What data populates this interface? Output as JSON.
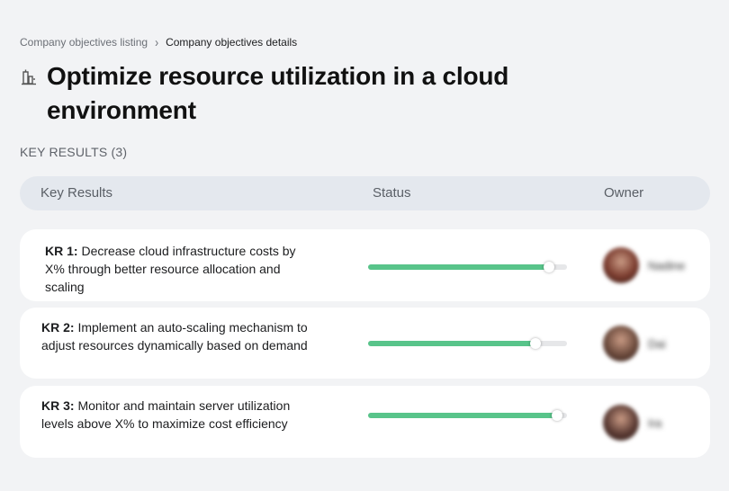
{
  "breadcrumb": {
    "parent": "Company objectives listing",
    "separator": "›",
    "current": "Company objectives details"
  },
  "objective": {
    "icon": "building-chart-icon",
    "title": "Optimize resource utilization in a cloud environment"
  },
  "key_results_section": {
    "label": "KEY RESULTS (3)"
  },
  "table": {
    "columns": [
      "Key Results",
      "Status",
      "Owner"
    ]
  },
  "key_results": [
    {
      "tag": "KR 1:",
      "text": "Decrease cloud infrastructure costs by X% through better resource allocation and scaling",
      "progress_fraction": 0.91,
      "owner": "Nadine",
      "avatar_color": "#7a3b2e"
    },
    {
      "tag": "KR 2:",
      "text": "Implement an auto-scaling mechanism to adjust resources dynamically based on demand",
      "progress_fraction": 0.84,
      "owner": "Dai",
      "avatar_color": "#6b4a3c"
    },
    {
      "tag": "KR 3:",
      "text": "Monitor and maintain server utilization levels above X% to maximize cost efficiency",
      "progress_fraction": 0.95,
      "owner": "Ira",
      "avatar_color": "#5a3a33"
    }
  ],
  "colors": {
    "background": "#f2f3f5",
    "header_bg": "#e4e8ee",
    "progress_fill": "#58c48a",
    "progress_track": "#e6e7e9"
  }
}
